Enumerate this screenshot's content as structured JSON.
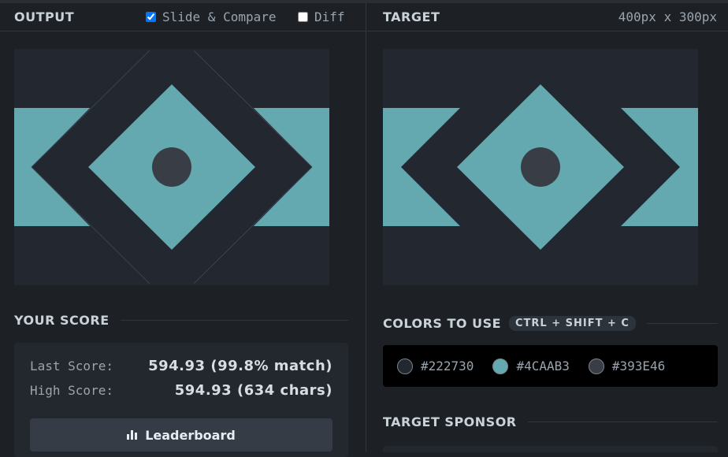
{
  "output": {
    "title": "OUTPUT",
    "slide_compare_label": "Slide & Compare",
    "slide_compare_checked": true,
    "diff_label": "Diff",
    "diff_checked": false
  },
  "target": {
    "title": "TARGET",
    "dimensions": "400px x 300px"
  },
  "score": {
    "heading": "YOUR SCORE",
    "last_label": "Last Score:",
    "last_value": "594.93 (99.8% match)",
    "high_label": "High Score:",
    "high_value": "594.93 (634 chars)",
    "leaderboard_label": "Leaderboard"
  },
  "colors": {
    "heading": "COLORS TO USE",
    "shortcut": "CTRL + SHIFT + C",
    "swatches": [
      {
        "hex": "#222730",
        "color": "#222730"
      },
      {
        "hex": "#4CAAB3",
        "color": "#4CAAB3"
      },
      {
        "hex": "#393E46",
        "color": "#393E46"
      }
    ]
  },
  "sponsor": {
    "heading": "TARGET SPONSOR"
  },
  "icons": {
    "leaderboard": "bar-chart-icon"
  }
}
